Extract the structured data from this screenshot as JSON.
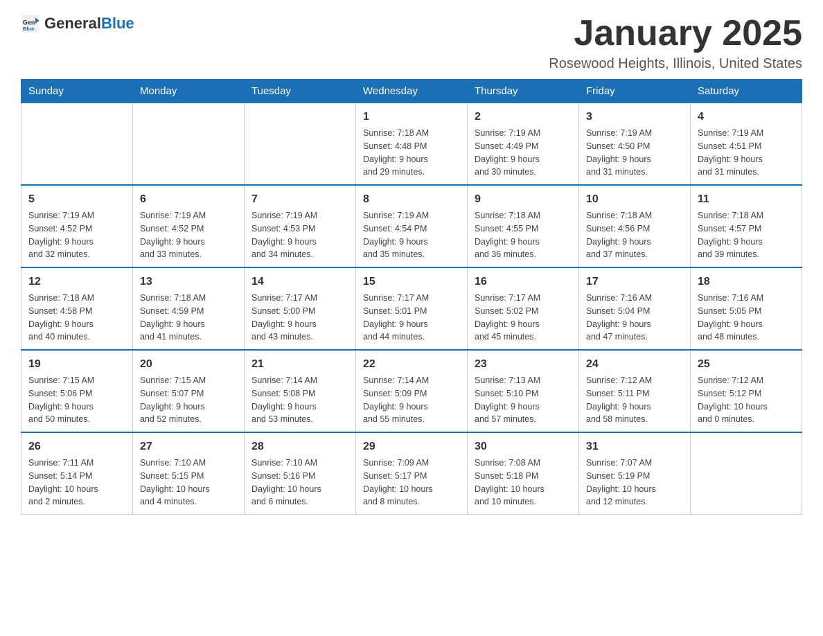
{
  "header": {
    "logo": {
      "text_general": "General",
      "text_blue": "Blue",
      "arrow": "▶"
    },
    "title": "January 2025",
    "subtitle": "Rosewood Heights, Illinois, United States"
  },
  "weekdays": [
    "Sunday",
    "Monday",
    "Tuesday",
    "Wednesday",
    "Thursday",
    "Friday",
    "Saturday"
  ],
  "weeks": [
    [
      {
        "day": "",
        "info": ""
      },
      {
        "day": "",
        "info": ""
      },
      {
        "day": "",
        "info": ""
      },
      {
        "day": "1",
        "info": "Sunrise: 7:18 AM\nSunset: 4:48 PM\nDaylight: 9 hours\nand 29 minutes."
      },
      {
        "day": "2",
        "info": "Sunrise: 7:19 AM\nSunset: 4:49 PM\nDaylight: 9 hours\nand 30 minutes."
      },
      {
        "day": "3",
        "info": "Sunrise: 7:19 AM\nSunset: 4:50 PM\nDaylight: 9 hours\nand 31 minutes."
      },
      {
        "day": "4",
        "info": "Sunrise: 7:19 AM\nSunset: 4:51 PM\nDaylight: 9 hours\nand 31 minutes."
      }
    ],
    [
      {
        "day": "5",
        "info": "Sunrise: 7:19 AM\nSunset: 4:52 PM\nDaylight: 9 hours\nand 32 minutes."
      },
      {
        "day": "6",
        "info": "Sunrise: 7:19 AM\nSunset: 4:52 PM\nDaylight: 9 hours\nand 33 minutes."
      },
      {
        "day": "7",
        "info": "Sunrise: 7:19 AM\nSunset: 4:53 PM\nDaylight: 9 hours\nand 34 minutes."
      },
      {
        "day": "8",
        "info": "Sunrise: 7:19 AM\nSunset: 4:54 PM\nDaylight: 9 hours\nand 35 minutes."
      },
      {
        "day": "9",
        "info": "Sunrise: 7:18 AM\nSunset: 4:55 PM\nDaylight: 9 hours\nand 36 minutes."
      },
      {
        "day": "10",
        "info": "Sunrise: 7:18 AM\nSunset: 4:56 PM\nDaylight: 9 hours\nand 37 minutes."
      },
      {
        "day": "11",
        "info": "Sunrise: 7:18 AM\nSunset: 4:57 PM\nDaylight: 9 hours\nand 39 minutes."
      }
    ],
    [
      {
        "day": "12",
        "info": "Sunrise: 7:18 AM\nSunset: 4:58 PM\nDaylight: 9 hours\nand 40 minutes."
      },
      {
        "day": "13",
        "info": "Sunrise: 7:18 AM\nSunset: 4:59 PM\nDaylight: 9 hours\nand 41 minutes."
      },
      {
        "day": "14",
        "info": "Sunrise: 7:17 AM\nSunset: 5:00 PM\nDaylight: 9 hours\nand 43 minutes."
      },
      {
        "day": "15",
        "info": "Sunrise: 7:17 AM\nSunset: 5:01 PM\nDaylight: 9 hours\nand 44 minutes."
      },
      {
        "day": "16",
        "info": "Sunrise: 7:17 AM\nSunset: 5:02 PM\nDaylight: 9 hours\nand 45 minutes."
      },
      {
        "day": "17",
        "info": "Sunrise: 7:16 AM\nSunset: 5:04 PM\nDaylight: 9 hours\nand 47 minutes."
      },
      {
        "day": "18",
        "info": "Sunrise: 7:16 AM\nSunset: 5:05 PM\nDaylight: 9 hours\nand 48 minutes."
      }
    ],
    [
      {
        "day": "19",
        "info": "Sunrise: 7:15 AM\nSunset: 5:06 PM\nDaylight: 9 hours\nand 50 minutes."
      },
      {
        "day": "20",
        "info": "Sunrise: 7:15 AM\nSunset: 5:07 PM\nDaylight: 9 hours\nand 52 minutes."
      },
      {
        "day": "21",
        "info": "Sunrise: 7:14 AM\nSunset: 5:08 PM\nDaylight: 9 hours\nand 53 minutes."
      },
      {
        "day": "22",
        "info": "Sunrise: 7:14 AM\nSunset: 5:09 PM\nDaylight: 9 hours\nand 55 minutes."
      },
      {
        "day": "23",
        "info": "Sunrise: 7:13 AM\nSunset: 5:10 PM\nDaylight: 9 hours\nand 57 minutes."
      },
      {
        "day": "24",
        "info": "Sunrise: 7:12 AM\nSunset: 5:11 PM\nDaylight: 9 hours\nand 58 minutes."
      },
      {
        "day": "25",
        "info": "Sunrise: 7:12 AM\nSunset: 5:12 PM\nDaylight: 10 hours\nand 0 minutes."
      }
    ],
    [
      {
        "day": "26",
        "info": "Sunrise: 7:11 AM\nSunset: 5:14 PM\nDaylight: 10 hours\nand 2 minutes."
      },
      {
        "day": "27",
        "info": "Sunrise: 7:10 AM\nSunset: 5:15 PM\nDaylight: 10 hours\nand 4 minutes."
      },
      {
        "day": "28",
        "info": "Sunrise: 7:10 AM\nSunset: 5:16 PM\nDaylight: 10 hours\nand 6 minutes."
      },
      {
        "day": "29",
        "info": "Sunrise: 7:09 AM\nSunset: 5:17 PM\nDaylight: 10 hours\nand 8 minutes."
      },
      {
        "day": "30",
        "info": "Sunrise: 7:08 AM\nSunset: 5:18 PM\nDaylight: 10 hours\nand 10 minutes."
      },
      {
        "day": "31",
        "info": "Sunrise: 7:07 AM\nSunset: 5:19 PM\nDaylight: 10 hours\nand 12 minutes."
      },
      {
        "day": "",
        "info": ""
      }
    ]
  ]
}
